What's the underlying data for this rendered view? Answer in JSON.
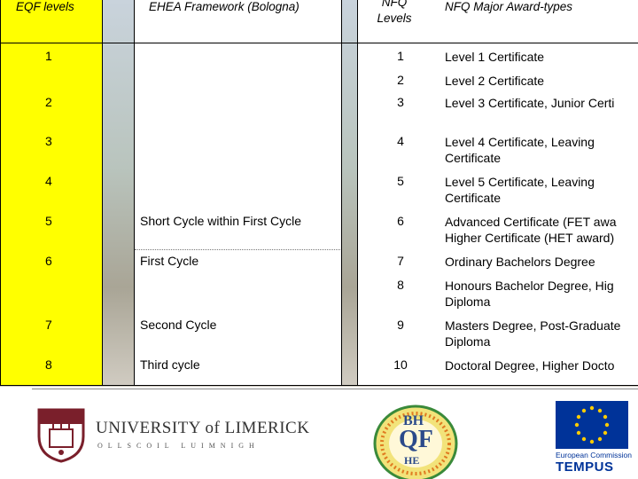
{
  "headers": {
    "eqf": "EQF levels",
    "ehea": "EHEA Framework (Bologna)",
    "nfq_levels": "NFQ\nLevels",
    "nfq_awards": "NFQ Major Award-types"
  },
  "eqf_levels": [
    "1",
    "2",
    "3",
    "4",
    "5",
    "6",
    "7",
    "8"
  ],
  "ehea": [
    "Short Cycle within First Cycle",
    "First Cycle",
    "Second Cycle",
    "Third cycle"
  ],
  "nfq_rows": [
    {
      "level": "1",
      "award": "Level 1 Certificate"
    },
    {
      "level": "2",
      "award": "Level 2 Certificate"
    },
    {
      "level": "3",
      "award": "Level 3 Certificate, Junior Certi"
    },
    {
      "level": "4",
      "award": "Level 4 Certificate, Leaving Certificate"
    },
    {
      "level": "5",
      "award": "Level 5 Certificate, Leaving Certificate"
    },
    {
      "level": "6",
      "award": "Advanced Certificate (FET awa Higher Certificate (HET award)"
    },
    {
      "level": "7",
      "award": "Ordinary Bachelors Degree"
    },
    {
      "level": "8",
      "award": "Honours Bachelor Degree, Hig Diploma"
    },
    {
      "level": "9",
      "award": "Masters Degree, Post-Graduate Diploma"
    },
    {
      "level": "10",
      "award": "Doctoral Degree, Higher Docto"
    }
  ],
  "logos": {
    "ul_title": "UNIVERSITY of LIMERICK",
    "ul_subtitle": "OLLSCOIL LUIMNIGH",
    "bhqf_top": "BH",
    "bhqf_mid": "QF",
    "bhqf_bottom": "HE",
    "eu_caption": "European Commission",
    "tempus": "TEMPUS"
  },
  "colors": {
    "eqf_fill": "#ffff00",
    "eu_blue": "#003399",
    "ul_maroon": "#7a1f2b"
  }
}
